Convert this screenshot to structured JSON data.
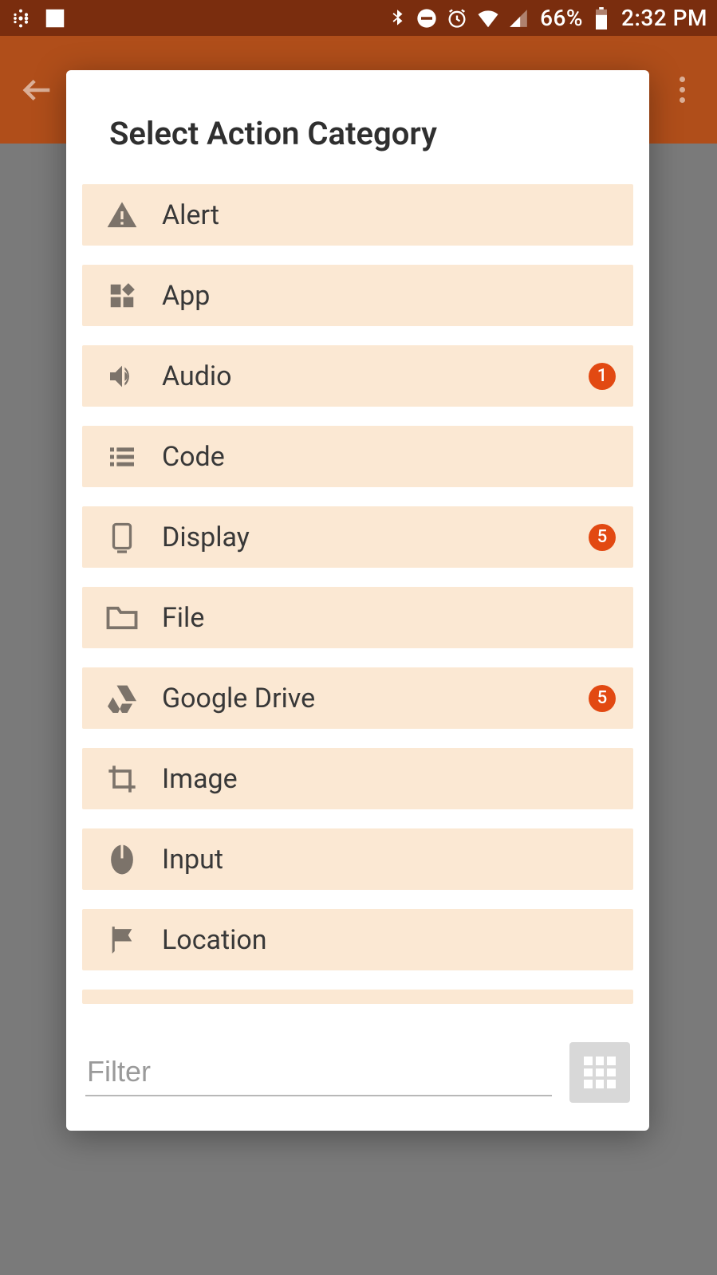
{
  "status_bar": {
    "battery_pct": "66%",
    "time": "2:32 PM"
  },
  "dialog": {
    "title": "Select Action Category",
    "filter_placeholder": "Filter",
    "categories": [
      {
        "icon": "alert-icon",
        "label": "Alert",
        "badge": null
      },
      {
        "icon": "app-icon",
        "label": "App",
        "badge": null
      },
      {
        "icon": "audio-icon",
        "label": "Audio",
        "badge": "1"
      },
      {
        "icon": "code-icon",
        "label": "Code",
        "badge": null
      },
      {
        "icon": "display-icon",
        "label": "Display",
        "badge": "5"
      },
      {
        "icon": "file-icon",
        "label": "File",
        "badge": null
      },
      {
        "icon": "google-drive-icon",
        "label": "Google Drive",
        "badge": "5"
      },
      {
        "icon": "image-icon",
        "label": "Image",
        "badge": null
      },
      {
        "icon": "input-icon",
        "label": "Input",
        "badge": null
      },
      {
        "icon": "location-icon",
        "label": "Location",
        "badge": null
      }
    ]
  }
}
